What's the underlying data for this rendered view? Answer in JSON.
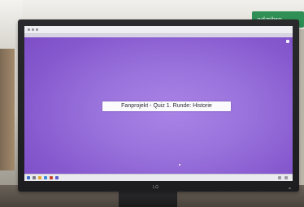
{
  "screen": {
    "title_card": "Fanprojekt - Quiz 1. Runde: Historie"
  },
  "monitor": {
    "brand": "LG"
  },
  "background": {
    "sign_text": "adæbro"
  },
  "colors": {
    "screen_purple": "#9a74dc",
    "bezel": "#1f1f21",
    "card": "#fbfbfd",
    "sign_green": "#2f8f55"
  }
}
